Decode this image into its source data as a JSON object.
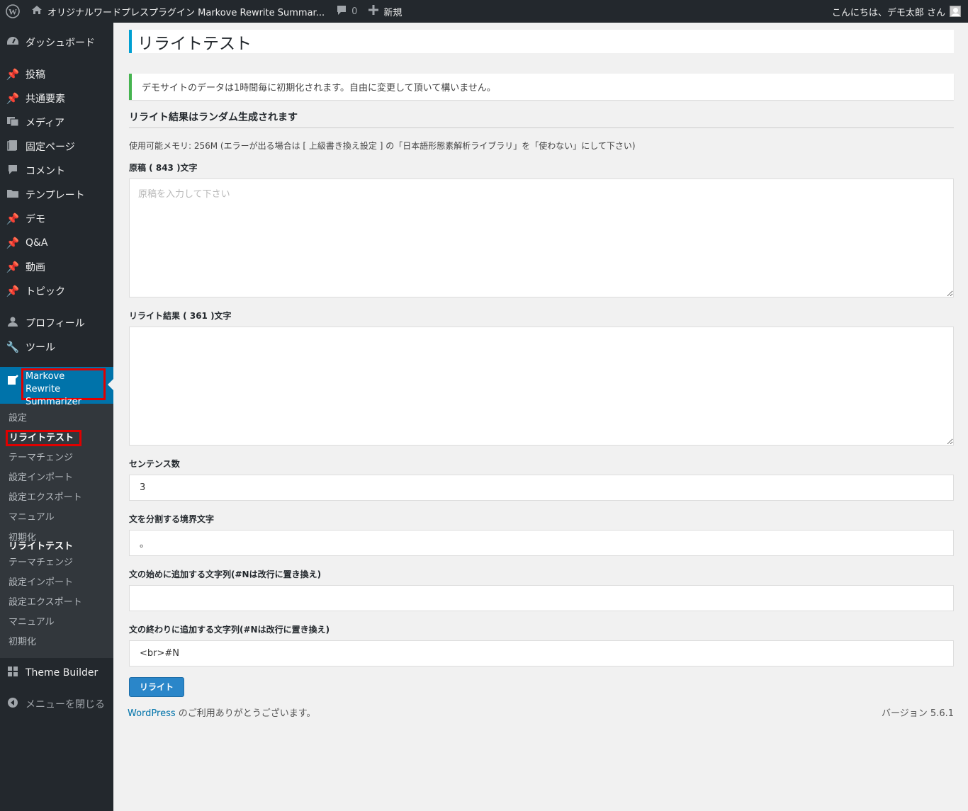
{
  "adminbar": {
    "site_name": "オリジナルワードプレスプラグイン Markove Rewrite Summar...",
    "comment_count": "0",
    "new_label": "新規",
    "greeting": "こんにちは、デモ太郎 さん"
  },
  "sidebar": {
    "items": [
      {
        "label": "ダッシュボード",
        "icon": "dashboard-icon"
      },
      {
        "label": "投稿",
        "icon": "pin-icon"
      },
      {
        "label": "共通要素",
        "icon": "pin-icon"
      },
      {
        "label": "メディア",
        "icon": "media-icon"
      },
      {
        "label": "固定ページ",
        "icon": "page-icon"
      },
      {
        "label": "コメント",
        "icon": "comment-icon"
      },
      {
        "label": "テンプレート",
        "icon": "folder-icon"
      },
      {
        "label": "デモ",
        "icon": "pin-icon"
      },
      {
        "label": "Q&A",
        "icon": "pin-icon"
      },
      {
        "label": "動画",
        "icon": "pin-icon"
      },
      {
        "label": "トピック",
        "icon": "pin-icon"
      },
      {
        "label": "プロフィール",
        "icon": "user-icon"
      },
      {
        "label": "ツール",
        "icon": "wrench-icon"
      }
    ],
    "current_menu": "Markove Rewrite Summarizer",
    "submenu": [
      "設定",
      "リライトテスト",
      "テーマチェンジ",
      "設定インポート",
      "設定エクスポート",
      "マニュアル",
      "初期化",
      "リライトテスト",
      "テーマチェンジ",
      "設定インポート",
      "設定エクスポート",
      "マニュアル",
      "初期化"
    ],
    "theme_builder": "Theme Builder",
    "collapse": "メニューを閉じる"
  },
  "main": {
    "title": "リライトテスト",
    "notice": "デモサイトのデータは1時間毎に初期化されます。自由に変更して頂いて構いません。",
    "section_title": "リライト結果はランダム生成されます",
    "memory": "使用可能メモリ: 256M (エラーが出る場合は [ 上級書き換え設定 ] の「日本語形態素解析ライブラリ」を「使わない」にして下さい)",
    "source_label": "原稿 ( 843 )文字",
    "source_placeholder": "原稿を入力して下さい",
    "result_label": "リライト結果 ( 361 )文字",
    "sentence_label": "センテンス数",
    "sentence_value": "3",
    "delimiter_label": "文を分割する境界文字",
    "delimiter_value": "。",
    "prefix_label": "文の始めに追加する文字列(#Nは改行に置き換え)",
    "prefix_value": "",
    "suffix_label": "文の終わりに追加する文字列(#Nは改行に置き換え)",
    "suffix_value": "<br>#N",
    "button": "リライト"
  },
  "footer": {
    "link": "WordPress",
    "thanks": " のご利用ありがとうございます。",
    "version": "バージョン 5.6.1"
  }
}
